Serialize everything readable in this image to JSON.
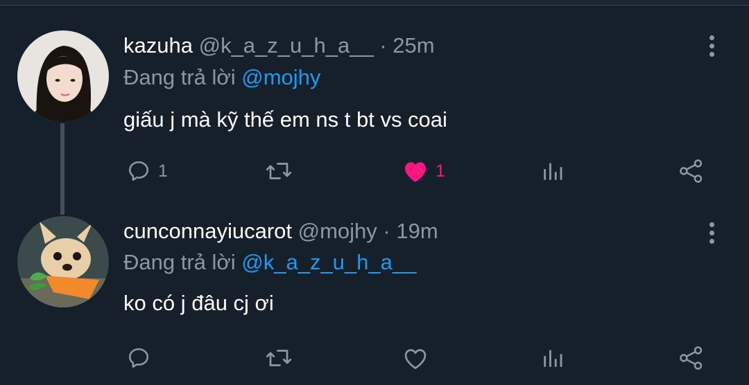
{
  "tweets": [
    {
      "name": "kazuha",
      "handle": "@k_a_z_u_h_a__",
      "separator": "·",
      "time": "25m",
      "replying_label": "Đang trả lời",
      "replying_to": "@mojhy",
      "text": "giấu j mà kỹ thế em ns t bt vs coai",
      "reply_count": "1",
      "retweet_count": "",
      "like_count": "1",
      "liked": true
    },
    {
      "name": "cunconnayiucarot",
      "handle": "@mojhy",
      "separator": "·",
      "time": "19m",
      "replying_label": "Đang trả lời",
      "replying_to": "@k_a_z_u_h_a__",
      "text": "ko có j đâu cj ơi",
      "reply_count": "",
      "retweet_count": "",
      "like_count": "",
      "liked": false
    }
  ],
  "colors": {
    "background": "#15202b",
    "secondary_text": "#8b98a5",
    "mention": "#1d9bf0",
    "like": "#f91880"
  },
  "icons": [
    "more-icon",
    "reply-icon",
    "retweet-icon",
    "like-icon",
    "analytics-icon",
    "share-icon"
  ]
}
